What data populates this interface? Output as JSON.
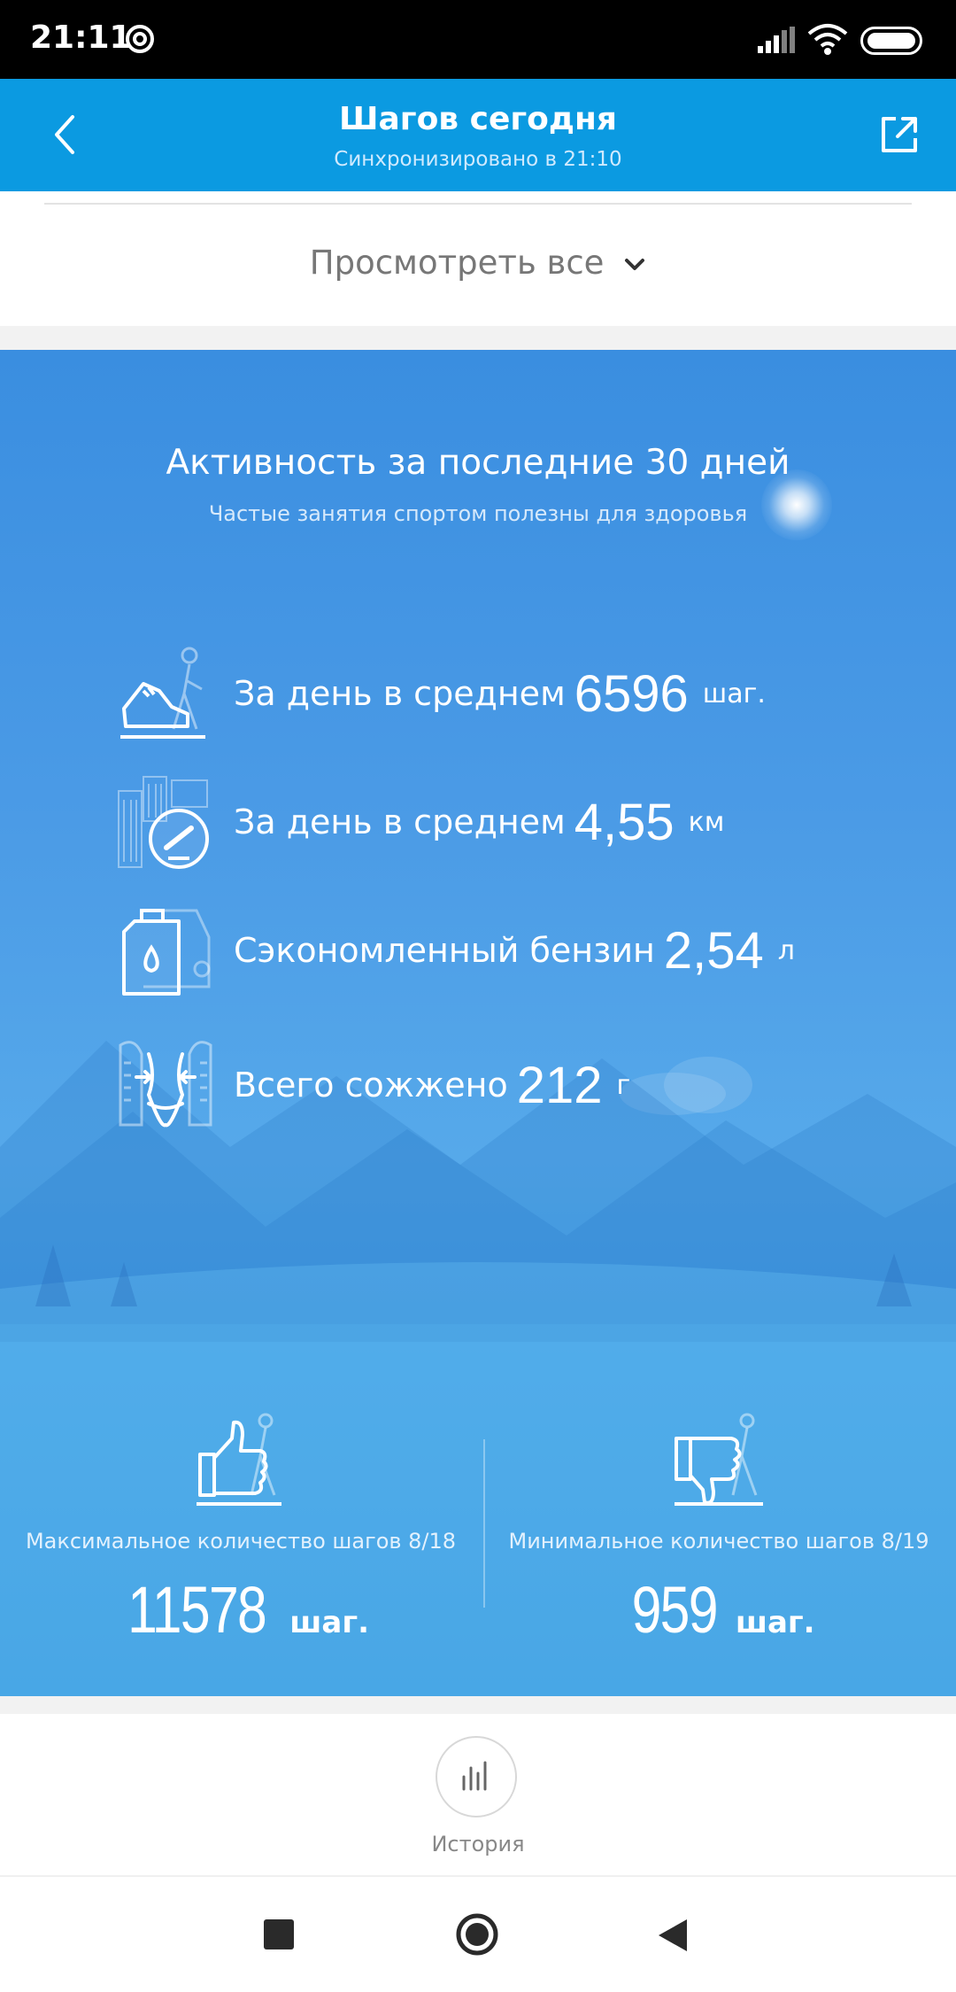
{
  "status_bar": {
    "time": "21:11",
    "icons": [
      "at-sign-icon",
      "signal-icon",
      "wifi-icon",
      "battery-icon"
    ]
  },
  "header": {
    "title": "Шагов сегодня",
    "subtitle": "Синхронизировано в 21:10",
    "back_icon": "chevron-left-icon",
    "share_icon": "share-icon"
  },
  "view_all": {
    "label": "Просмотреть все"
  },
  "activity": {
    "title": "Активность за последние 30 дней",
    "subtitle": "Частые занятия спортом полезны для здоровья",
    "stats": [
      {
        "icon": "walking-shoe-icon",
        "label": "За день в среднем",
        "value": "6596",
        "unit": "шаг."
      },
      {
        "icon": "speedometer-icon",
        "label": "За день в среднем",
        "value": "4,55",
        "unit": "км"
      },
      {
        "icon": "fuel-can-icon",
        "label": "Сэкономленный бензин",
        "value": "2,54",
        "unit": "л"
      },
      {
        "icon": "waist-icon",
        "label": "Всего сожжено",
        "value": "212",
        "unit": "г"
      }
    ]
  },
  "records": {
    "max": {
      "icon": "thumbs-up-icon",
      "label": "Максимальное количество шагов 8/18",
      "value": "11578",
      "unit": "шаг."
    },
    "min": {
      "icon": "thumbs-down-icon",
      "label": "Минимальное количество шагов 8/19",
      "value": "959",
      "unit": "шаг."
    }
  },
  "history": {
    "label": "История",
    "icon": "bar-chart-icon"
  },
  "nav": {
    "icons": [
      "recents-icon",
      "home-icon",
      "back-icon"
    ]
  },
  "colors": {
    "appbar": "#0b9ae1",
    "panel": "#4b9be6",
    "statusbar": "#000000"
  }
}
